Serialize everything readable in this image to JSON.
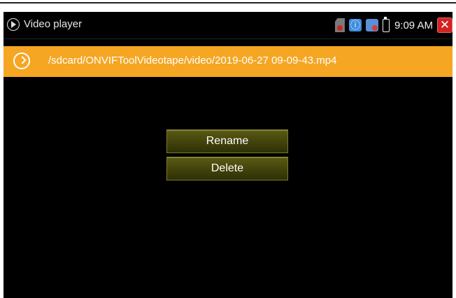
{
  "status_bar": {
    "app_title": "Video player",
    "time": "9:09 AM"
  },
  "path_bar": {
    "path": "/sdcard/ONVIFToolVideotape/video/2019-06-27 09-09-43.mp4"
  },
  "menu": {
    "rename_label": "Rename",
    "delete_label": "Delete"
  },
  "colors": {
    "path_bar_bg": "#f5a623",
    "button_bg": "#4a4b10",
    "close_red": "#d32222"
  }
}
